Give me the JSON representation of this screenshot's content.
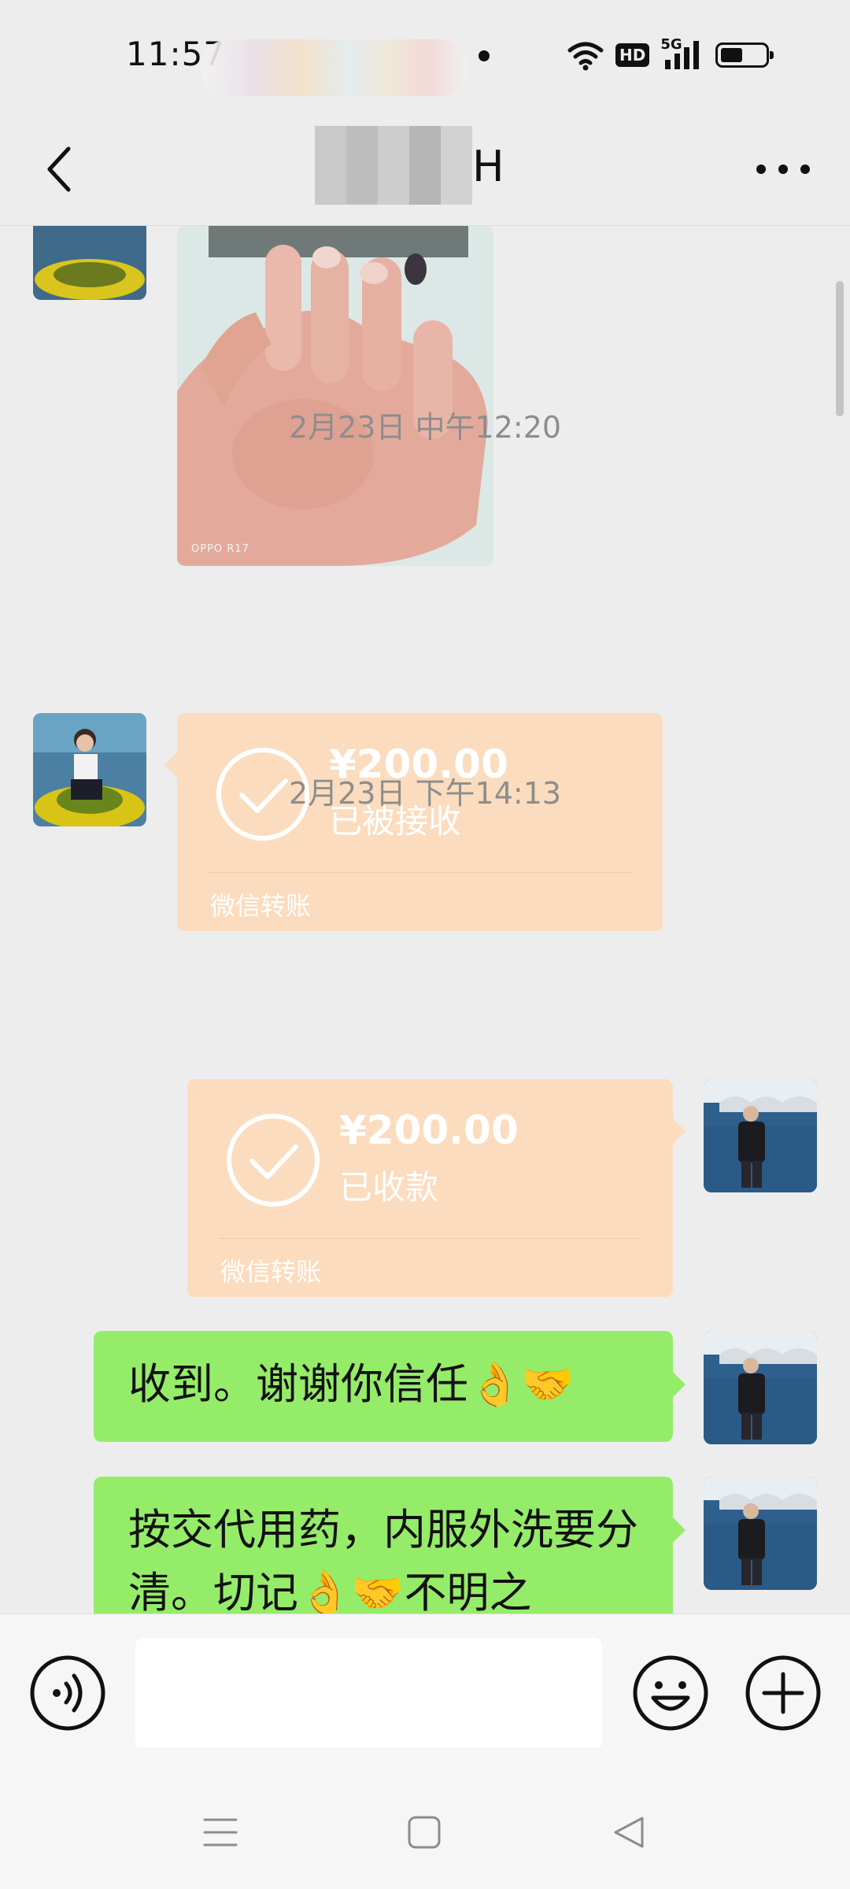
{
  "status_bar": {
    "time": "11:57",
    "signal_label": "5G",
    "hd_label": "HD",
    "battery_level": 0.5
  },
  "nav": {
    "title": "H",
    "back_icon": "chevron-left-icon",
    "more_icon": "more-dots-icon"
  },
  "chat": {
    "photo_watermark": "OPPO R17",
    "messages": [
      {
        "type": "timestamp",
        "text": "2月23日 中午12:20"
      },
      {
        "type": "transfer",
        "direction": "received",
        "amount": "¥200.00",
        "status": "已被接收",
        "label": "微信转账"
      },
      {
        "type": "timestamp",
        "text": "2月23日 下午14:13"
      },
      {
        "type": "transfer",
        "direction": "sent",
        "amount": "¥200.00",
        "status": "已收款",
        "label": "微信转账"
      },
      {
        "type": "text",
        "direction": "sent",
        "text": "收到。谢谢你信任👌🤝"
      },
      {
        "type": "text",
        "direction": "sent",
        "text": "按交代用药，内服外洗要分清。切记👌🤝不明之"
      }
    ]
  },
  "input_bar": {
    "voice_icon": "voice-icon",
    "emoji_icon": "emoji-icon",
    "plus_icon": "plus-icon",
    "text_value": ""
  },
  "system_nav": {
    "menu_icon": "menu-icon",
    "home_icon": "home-icon",
    "back_icon": "back-triangle-icon"
  },
  "colors": {
    "background": "#ededed",
    "transfer_bubble": "#fbdcbe",
    "sent_bubble": "#95ec69"
  }
}
